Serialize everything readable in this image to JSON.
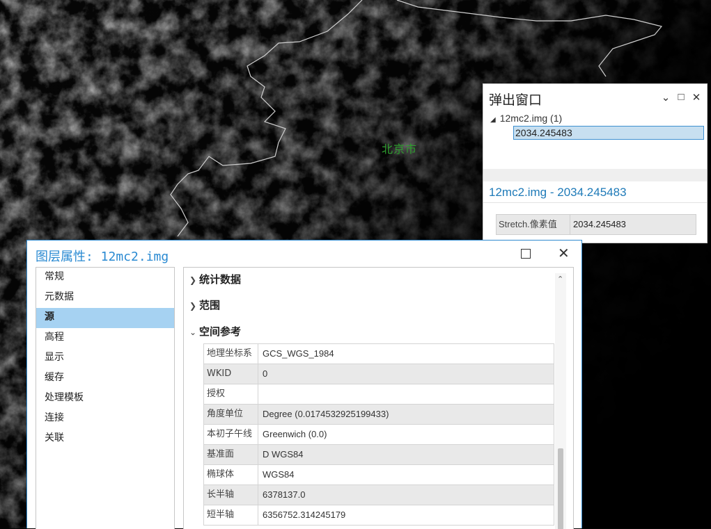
{
  "map": {
    "city_label": "北京市"
  },
  "popup": {
    "title": "弹出窗口",
    "controls": {
      "dropdown": "⌄",
      "maximize": "□",
      "close": "✕"
    },
    "tree_root": "12mc2.img (1)",
    "tree_child": "2034.245483",
    "heading": "12mc2.img - 2034.245483",
    "attribute": {
      "key": "Stretch.像素值",
      "value": "2034.245483"
    }
  },
  "dialog": {
    "title": "图层属性: 12mc2.img",
    "nav": [
      "常规",
      "元数据",
      "源",
      "高程",
      "显示",
      "缓存",
      "处理模板",
      "连接",
      "关联"
    ],
    "active_nav": "源",
    "sections": [
      {
        "label": "统计数据",
        "expanded": false
      },
      {
        "label": "范围",
        "expanded": false
      },
      {
        "label": "空间参考",
        "expanded": true
      }
    ],
    "spatial_reference": [
      {
        "key": "地理坐标系",
        "value": "GCS_WGS_1984"
      },
      {
        "key": "WKID",
        "value": "0"
      },
      {
        "key": "授权",
        "value": ""
      },
      {
        "key": "角度单位",
        "value": "Degree (0.0174532925199433)"
      },
      {
        "key": "本初子午线",
        "value": "Greenwich (0.0)"
      },
      {
        "key": "基准面",
        "value": "D WGS84"
      },
      {
        "key": "椭球体",
        "value": "WGS84"
      },
      {
        "key": "长半轴",
        "value": "6378137.0"
      },
      {
        "key": "短半轴",
        "value": "6356752.314245179"
      }
    ]
  },
  "colors": {
    "accent": "#2a8ad2",
    "selected_nav": "#a6d2f2",
    "map_label": "#2e9d2e"
  }
}
